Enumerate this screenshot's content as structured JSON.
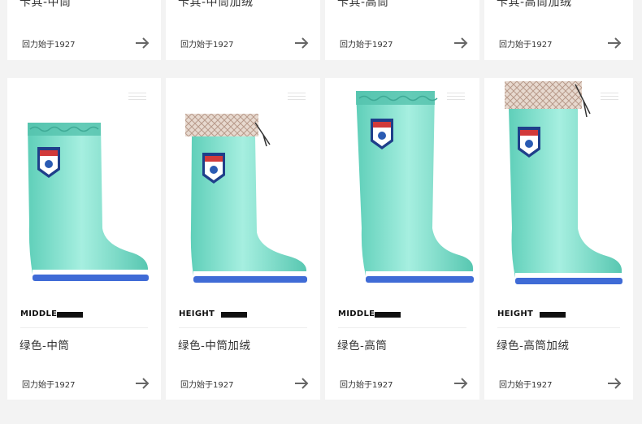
{
  "top_row": [
    {
      "title": "卡其-中筒",
      "brand": "回力始于1927"
    },
    {
      "title": "卡其-中筒加绒",
      "brand": "回力始于1927"
    },
    {
      "title": "卡其-高筒",
      "brand": "回力始于1927"
    },
    {
      "title": "卡其-高筒加绒",
      "brand": "回力始于1927"
    }
  ],
  "products": [
    {
      "tag": "MIDDLE",
      "name": "绿色-中筒",
      "brand": "回力始于1927"
    },
    {
      "tag": "HEIGHT",
      "name": "绿色-中筒加绒",
      "brand": "回力始于1927"
    },
    {
      "tag": "MIDDLE",
      "name": "绿色-高筒",
      "brand": "回力始于1927"
    },
    {
      "tag": "HEIGHT",
      "name": "绿色-高筒加绒",
      "brand": "回力始于1927"
    }
  ],
  "colors": {
    "boot": "#6dd8c4",
    "sole": "#3f6bd6",
    "accent": "#111111"
  }
}
